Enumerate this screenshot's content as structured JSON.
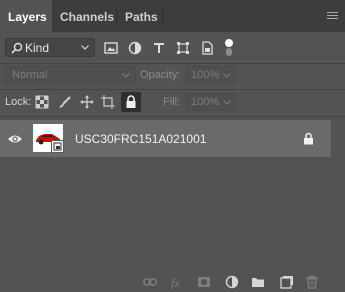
{
  "tabs": [
    {
      "label": "Layers",
      "active": true
    },
    {
      "label": "Channels",
      "active": false
    },
    {
      "label": "Paths",
      "active": false
    }
  ],
  "filter": {
    "kind_label": "Kind",
    "icons": [
      "image-filter-icon",
      "adjustment-filter-icon",
      "type-filter-icon",
      "shape-filter-icon",
      "smart-object-filter-icon",
      "filter-toggle-icon"
    ]
  },
  "blending": {
    "mode": "Normal",
    "opacity_label": "Opacity:",
    "opacity_value": "100%"
  },
  "lock": {
    "label": "Lock:",
    "fill_label": "Fill:",
    "fill_value": "100%",
    "icons": [
      "lock-transparent-pixels-icon",
      "lock-image-pixels-icon",
      "lock-position-icon",
      "lock-artboard-icon",
      "lock-all-icon"
    ]
  },
  "layers": [
    {
      "name": "USC30FRC151A021001",
      "visible": true,
      "locked": true,
      "type": "smart-object"
    }
  ],
  "bottom_icons": [
    "link-layers-icon",
    "add-layer-style-icon",
    "add-mask-icon",
    "new-adjustment-layer-icon",
    "new-group-icon",
    "new-layer-icon",
    "delete-layer-icon"
  ],
  "colors": {
    "panel_bg": "#535353",
    "tabbar_bg": "#3d3d3d",
    "selected_layer_bg": "#6a6a6a"
  }
}
